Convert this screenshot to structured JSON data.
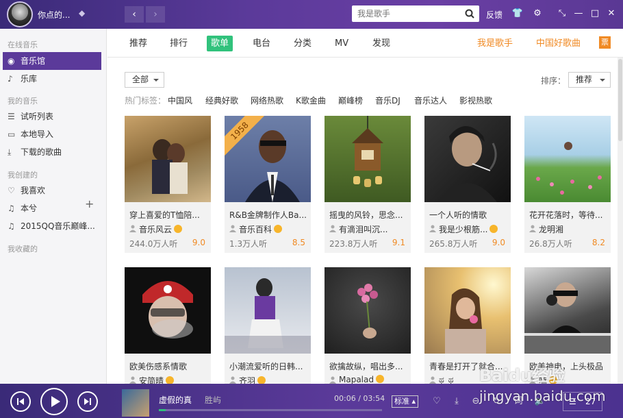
{
  "app": {
    "username": "你点的...",
    "search_placeholder": "我是歌手",
    "feedback": "反馈"
  },
  "sidebar": {
    "sections": [
      {
        "label": "在线音乐"
      },
      {
        "label": "我的音乐"
      },
      {
        "label": "我创建的"
      },
      {
        "label": "我收藏的"
      }
    ],
    "online": [
      {
        "label": "音乐馆",
        "icon": "music-hall-icon"
      },
      {
        "label": "乐库",
        "icon": "library-icon"
      }
    ],
    "mine": [
      {
        "label": "试听列表",
        "icon": "list-icon"
      },
      {
        "label": "本地导入",
        "icon": "monitor-icon"
      },
      {
        "label": "下载的歌曲",
        "icon": "download-icon"
      }
    ],
    "created": [
      {
        "label": "我喜欢",
        "icon": "heart-icon"
      },
      {
        "label": "本兮",
        "icon": "music-note-icon"
      },
      {
        "label": "2015QQ音乐巅峰...",
        "icon": "music-note-icon"
      }
    ]
  },
  "tabs": {
    "items": [
      "推荐",
      "排行",
      "歌单",
      "电台",
      "分类",
      "MV",
      "发现"
    ],
    "active": "歌单",
    "promo": [
      "我是歌手",
      "中国好歌曲"
    ],
    "ticket": "票"
  },
  "filter": {
    "category": "全部",
    "sort_label": "排序：",
    "sort_value": "推荐",
    "hot_label": "热门标签：",
    "tags": [
      "中国风",
      "经典好歌",
      "网络热歌",
      "K歌金曲",
      "巅峰榜",
      "音乐DJ",
      "音乐达人",
      "影视热歌"
    ]
  },
  "playlists": [
    {
      "title": "穿上喜爱的T恤陪...",
      "author": "音乐风云",
      "verified": true,
      "plays": "244.0万人听",
      "score": "9.0"
    },
    {
      "title": "R&B金牌制作人Ba...",
      "author": "音乐百科",
      "verified": true,
      "plays": "1.3万人听",
      "score": "8.5",
      "ribbon": "1958"
    },
    {
      "title": "摇曳的风铃，思念...",
      "author": "有滴泪叫沉...",
      "verified": false,
      "plays": "223.8万人听",
      "score": "9.1"
    },
    {
      "title": "一个人听的情歌",
      "author": "我是少根筋...",
      "verified": true,
      "plays": "265.8万人听",
      "score": "9.0"
    },
    {
      "title": "花开花落时，等待...",
      "author": "龙明湘",
      "verified": false,
      "plays": "26.8万人听",
      "score": "8.2"
    },
    {
      "title": "欧美伤感系情歌",
      "author": "安简晴",
      "verified": true,
      "plays": "",
      "score": ""
    },
    {
      "title": "小潮流爱听的日韩...",
      "author": "齐羽",
      "verified": true,
      "plays": "",
      "score": ""
    },
    {
      "title": "欲擒故纵，唱出多...",
      "author": "Mapalad",
      "verified": true,
      "plays": "",
      "score": ""
    },
    {
      "title": "青春是打开了就合...",
      "author": "ಥ_ಥ",
      "verified": false,
      "plays": "",
      "score": ""
    },
    {
      "title": "欧美神电，上头极品",
      "author": "嗑",
      "verified": true,
      "plays": "",
      "score": ""
    }
  ],
  "player": {
    "track": "虚假的真",
    "artist": "胜屿",
    "time": "00:06 / 03:54",
    "progress": 0.03,
    "quality": "标准",
    "playlist_count": "27"
  },
  "watermark": {
    "brand": "Baidu经验",
    "url": "jingyan.baidu.com"
  }
}
